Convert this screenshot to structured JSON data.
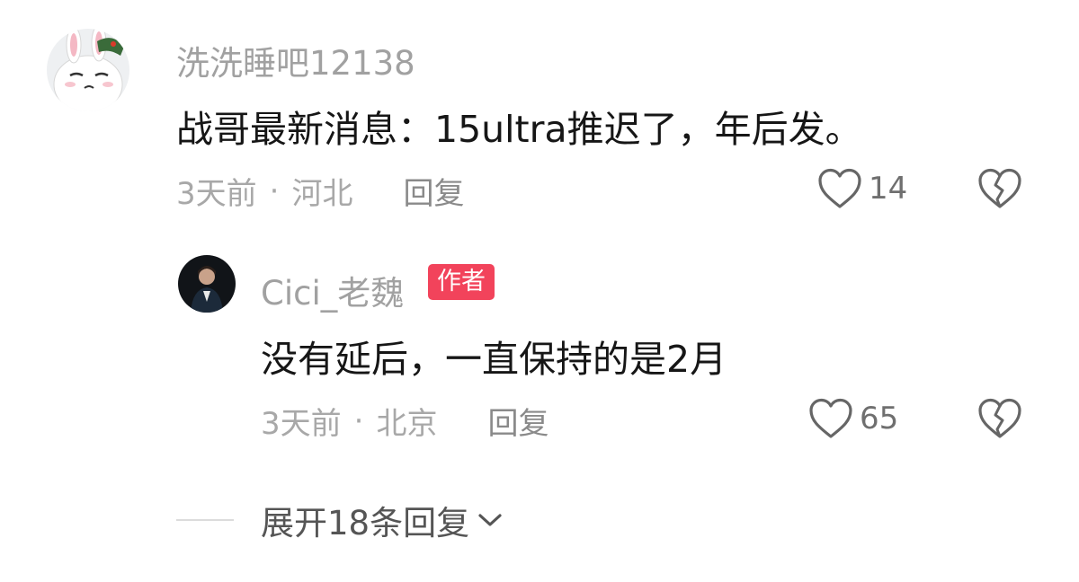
{
  "comments": [
    {
      "username": "洗洗睡吧12138",
      "text": "战哥最新消息：15ultra推迟了，年后发。",
      "time": "3天前",
      "separator": "·",
      "location": "河北",
      "reply_label": "回复",
      "likes": "14",
      "avatar_icon": "rabbit-avatar"
    },
    {
      "username": "Cici_老魏",
      "badge": "作者",
      "text": "没有延后，一直保持的是2月",
      "time": "3天前",
      "separator": "·",
      "location": "北京",
      "reply_label": "回复",
      "likes": "65",
      "avatar_icon": "person-avatar"
    }
  ],
  "expand_replies_label": "展开18条回复",
  "icons": {
    "like": "heart-outline-icon",
    "dislike": "broken-heart-icon",
    "expand": "chevron-down-icon"
  },
  "colors": {
    "badge": "#f2435b",
    "secondary_text": "#a1a1a1"
  }
}
